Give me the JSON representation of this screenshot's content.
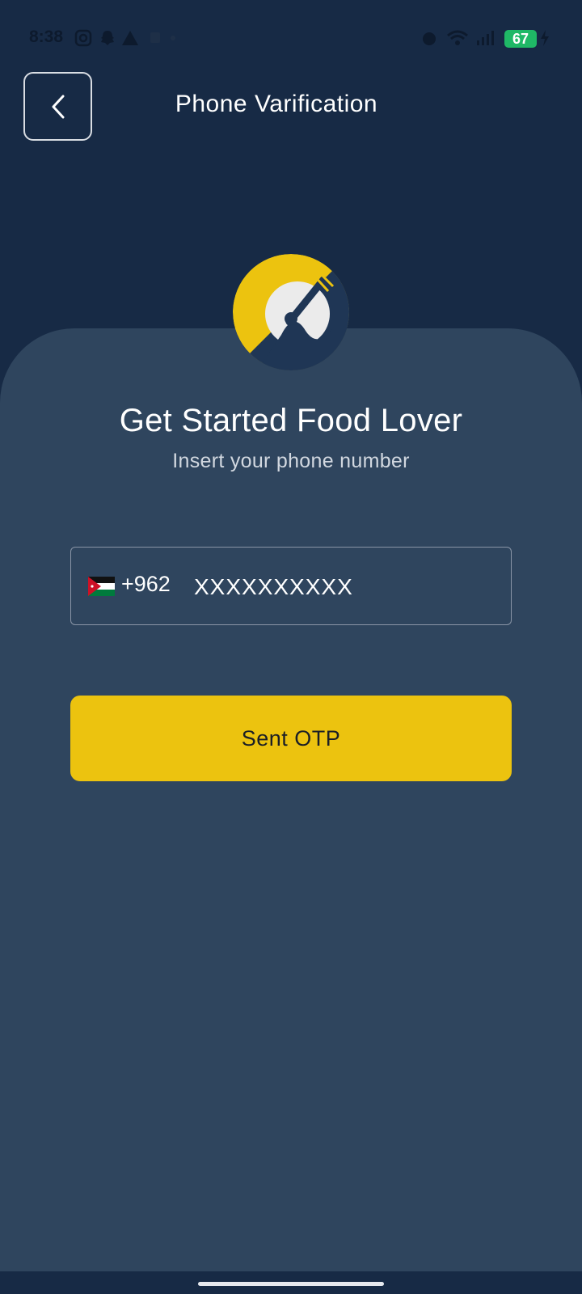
{
  "status_bar": {
    "time": "8:38",
    "battery": "67",
    "icons": [
      "instagram-icon",
      "snapchat-icon",
      "warning-icon",
      "sim-icon",
      "dot-icon",
      "alarm-icon",
      "wifi-icon",
      "signal-icon",
      "charging-icon"
    ]
  },
  "header": {
    "title": "Phone Varification",
    "back_icon": "chevron-left-icon"
  },
  "main": {
    "headline": "Get Started Food Lover",
    "subheadline": "Insert your phone number",
    "phone": {
      "country_flag": "jordan-flag-icon",
      "dial_code": "+962",
      "placeholder": "XXXXXXXXXX",
      "value": ""
    },
    "send_button": "Sent OTP"
  },
  "colors": {
    "background": "#172a45",
    "card": "#2f455e",
    "accent": "#ecc30f",
    "battery": "#1fb866"
  }
}
